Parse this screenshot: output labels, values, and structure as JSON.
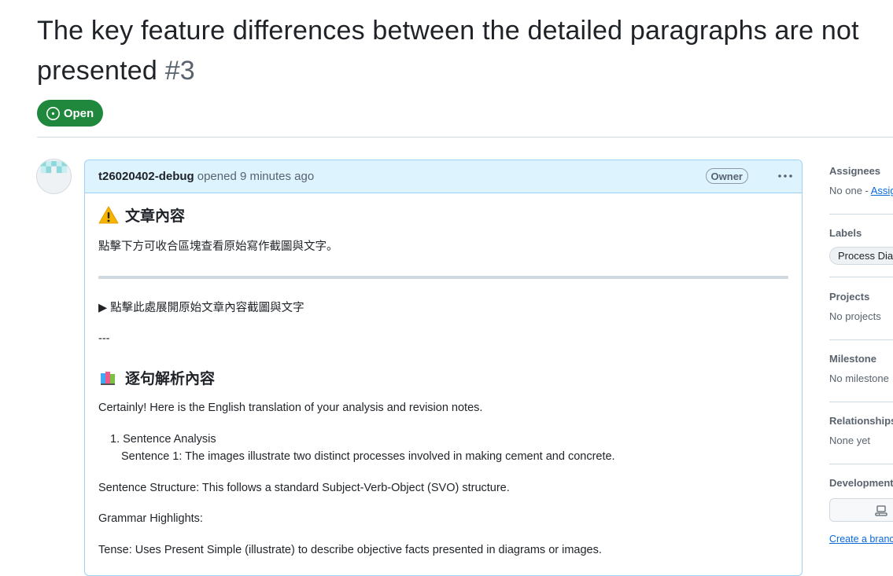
{
  "issue": {
    "title": "The key feature differences between the detailed paragraphs are not presented",
    "number": "#3",
    "state": "Open"
  },
  "comment": {
    "author": "t26020402-debug",
    "meta": "opened 9 minutes ago",
    "role_badge": "Owner",
    "heading1": "文章內容",
    "intro": "點擊下方可收合區塊查看原始寫作截圖與文字。",
    "details_summary": "▶ 點擊此處展開原始文章內容截圖與文字",
    "separator_text": "---",
    "heading2": "逐句解析內容",
    "translation_intro": "Certainly! Here is the English translation of your analysis and revision notes.",
    "list_item_1": "1. Sentence Analysis",
    "sentence_1": "Sentence 1: The images illustrate two distinct processes involved in making cement and concrete.",
    "structure": "Sentence Structure: This follows a standard Subject-Verb-Object (SVO) structure.",
    "grammar": "Grammar Highlights:",
    "tense": "Tense: Uses Present Simple (illustrate) to describe objective facts presented in diagrams or images."
  },
  "sidebar": {
    "assignees_label": "Assignees",
    "assignees_value": "No one - ",
    "assignees_link": "Assign yourself",
    "labels_label": "Labels",
    "label_pill": "Process Diagram",
    "projects_label": "Projects",
    "projects_value": "No projects",
    "milestone_label": "Milestone",
    "milestone_value": "No milestone",
    "relationships_label": "Relationships",
    "relationships_value": "None yet",
    "development_label": "Development",
    "development_link": "Create a branch"
  },
  "colors": {
    "open_green": "#1f883d",
    "comment_header_bg": "#ddf4ff",
    "comment_border": "#9cd1f5",
    "link_blue": "#0969da"
  },
  "icons": [
    "issue-opened-icon",
    "kebab-horizontal-icon",
    "warning-icon",
    "books-icon",
    "laptop-icon",
    "identicon-avatar"
  ]
}
